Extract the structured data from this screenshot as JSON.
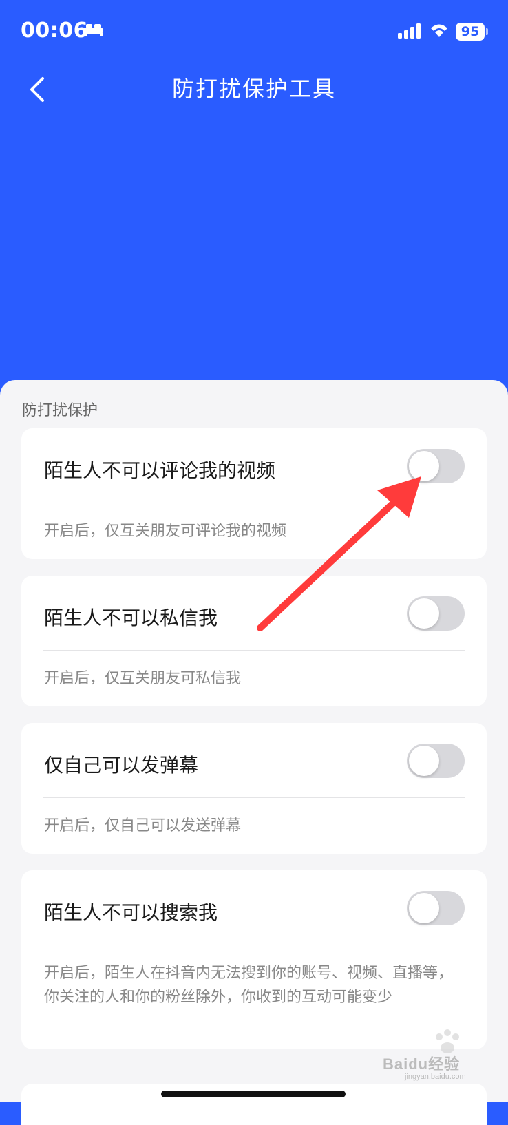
{
  "status_bar": {
    "time": "00:06",
    "battery": "95",
    "icons": [
      "bed-icon",
      "signal-icon",
      "wifi-icon",
      "battery-icon"
    ]
  },
  "nav": {
    "title": "防打扰保护工具",
    "back_icon": "chevron-left-icon"
  },
  "section": {
    "label": "防打扰保护"
  },
  "settings": [
    {
      "title": "陌生人不可以评论我的视频",
      "description": "开启后，仅互关朋友可评论我的视频",
      "enabled": false
    },
    {
      "title": "陌生人不可以私信我",
      "description": "开启后，仅互关朋友可私信我",
      "enabled": false
    },
    {
      "title": "仅自己可以发弹幕",
      "description": "开启后，仅自己可以发送弹幕",
      "enabled": false
    },
    {
      "title": "陌生人不可以搜索我",
      "description": "开启后，陌生人在抖音内无法搜到你的账号、视频、直播等，你关注的人和你的粉丝除外，你收到的互动可能变少",
      "enabled": false
    }
  ],
  "watermark": {
    "text": "Baidu经验",
    "sub": "jingyan.baidu.com"
  },
  "colors": {
    "header_bg": "#2a5cff",
    "sheet_bg": "#f5f5f7",
    "toggle_off": "#d8d8dc",
    "annotation_arrow": "#ff3b3b"
  }
}
